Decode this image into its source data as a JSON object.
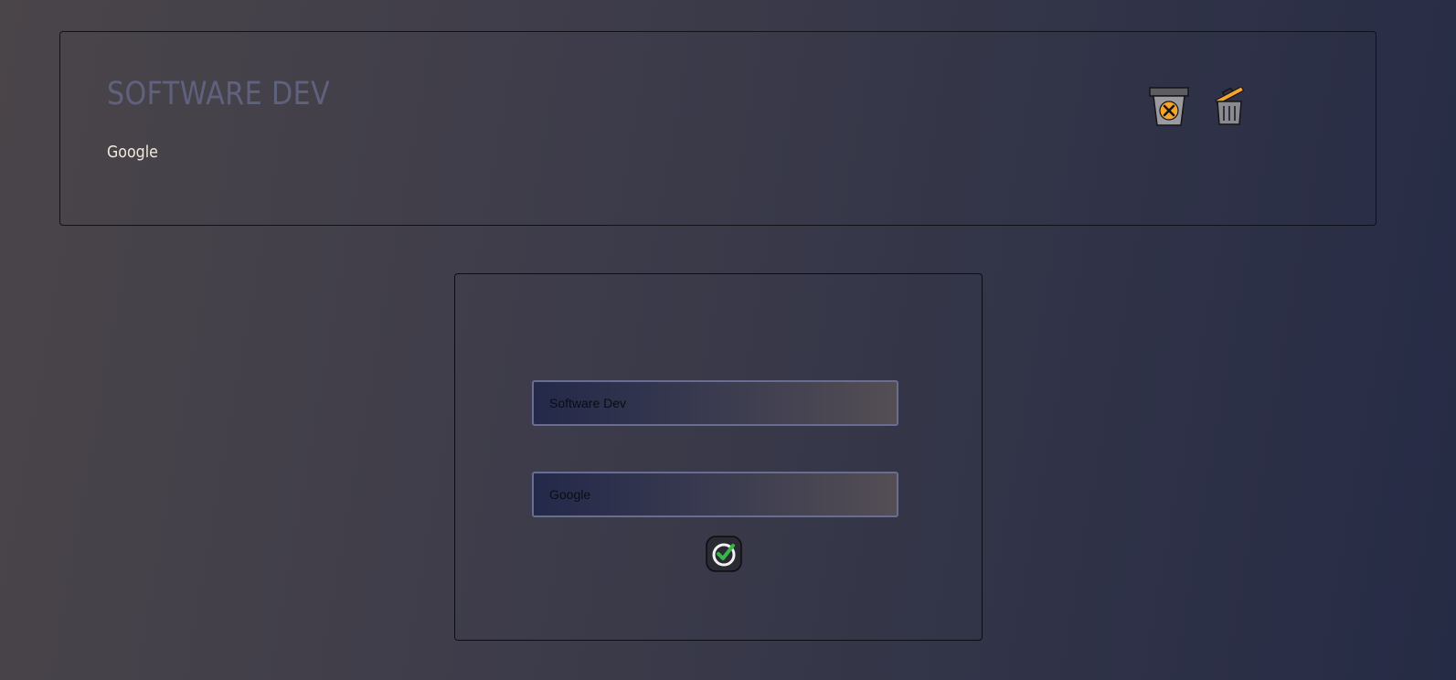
{
  "card": {
    "title": "SOFTWARE DEV",
    "subtitle": "Google",
    "cancel_icon": "trash-x-icon",
    "delete_icon": "trash-open-icon"
  },
  "form": {
    "title_value": "Software Dev",
    "company_value": "Google",
    "confirm_icon": "check-circle-icon"
  },
  "colors": {
    "title": "#5f627f",
    "subtitle": "#f1ead8",
    "accent_orange": "#f5a52a",
    "check_green": "#3ab54a",
    "field_border": "#6a6d92"
  }
}
